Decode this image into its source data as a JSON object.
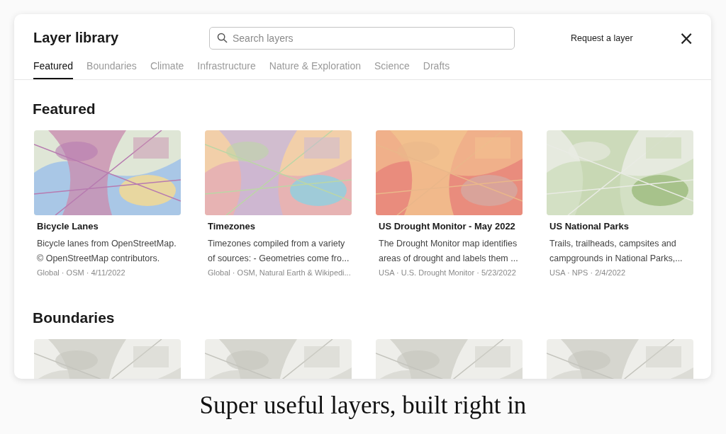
{
  "dialog": {
    "title": "Layer library",
    "search": {
      "placeholder": "Search layers"
    },
    "request_link": "Request a layer",
    "close": "×"
  },
  "tabs": [
    {
      "label": "Featured",
      "selected": true
    },
    {
      "label": "Boundaries",
      "selected": false
    },
    {
      "label": "Climate",
      "selected": false
    },
    {
      "label": "Infrastructure",
      "selected": false
    },
    {
      "label": "Nature & Exploration",
      "selected": false
    },
    {
      "label": "Science",
      "selected": false
    },
    {
      "label": "Drafts",
      "selected": false
    }
  ],
  "sections": [
    {
      "heading": "Featured",
      "cards": [
        {
          "kind": "layer",
          "title": "Bicycle Lanes",
          "description": "Bicycle lanes from OpenStreetMap. © OpenStreetMap contributors.",
          "meta": "Global · OSM · 4/11/2022"
        },
        {
          "kind": "layer",
          "title": "Timezones",
          "description": "Timezones compiled from a variety of sources: - Geometries come fro...",
          "meta": "Global · OSM, Natural Earth & Wikipedi..."
        },
        {
          "kind": "layer",
          "title": "US Drought Monitor - May 2022",
          "description": "The Drought Monitor map identifies areas of drought and labels them ...",
          "meta": "USA · U.S. Drought Monitor · 5/23/2022"
        },
        {
          "kind": "layer",
          "title": "US National Parks",
          "description": "Trails, trailheads, campsites and campgrounds in National Parks,...",
          "meta": "USA · NPS · 2/4/2022"
        }
      ]
    },
    {
      "heading": "Boundaries"
    }
  ],
  "caption": "Super useful layers, built right in"
}
